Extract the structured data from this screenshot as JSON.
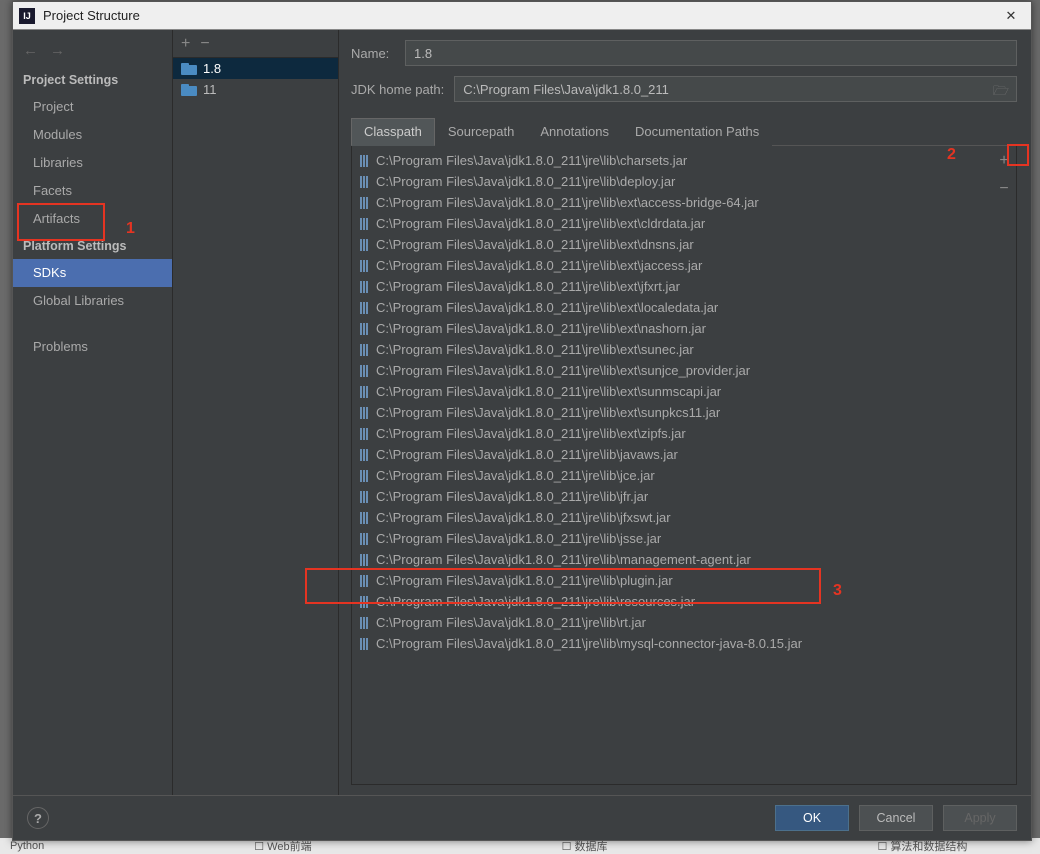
{
  "window": {
    "title": "Project Structure"
  },
  "sidebar": {
    "section1": "Project Settings",
    "section2": "Platform Settings",
    "items1": [
      "Project",
      "Modules",
      "Libraries",
      "Facets",
      "Artifacts"
    ],
    "items2": [
      "SDKs",
      "Global Libraries"
    ],
    "problems": "Problems"
  },
  "sdklist": {
    "items": [
      "1.8",
      "11"
    ]
  },
  "form": {
    "name_label": "Name:",
    "name_value": "1.8",
    "jdkhome_label": "JDK home path:",
    "jdkhome_value": "C:\\Program Files\\Java\\jdk1.8.0_211"
  },
  "tabs": [
    "Classpath",
    "Sourcepath",
    "Annotations",
    "Documentation Paths"
  ],
  "classpath": [
    "C:\\Program Files\\Java\\jdk1.8.0_211\\jre\\lib\\charsets.jar",
    "C:\\Program Files\\Java\\jdk1.8.0_211\\jre\\lib\\deploy.jar",
    "C:\\Program Files\\Java\\jdk1.8.0_211\\jre\\lib\\ext\\access-bridge-64.jar",
    "C:\\Program Files\\Java\\jdk1.8.0_211\\jre\\lib\\ext\\cldrdata.jar",
    "C:\\Program Files\\Java\\jdk1.8.0_211\\jre\\lib\\ext\\dnsns.jar",
    "C:\\Program Files\\Java\\jdk1.8.0_211\\jre\\lib\\ext\\jaccess.jar",
    "C:\\Program Files\\Java\\jdk1.8.0_211\\jre\\lib\\ext\\jfxrt.jar",
    "C:\\Program Files\\Java\\jdk1.8.0_211\\jre\\lib\\ext\\localedata.jar",
    "C:\\Program Files\\Java\\jdk1.8.0_211\\jre\\lib\\ext\\nashorn.jar",
    "C:\\Program Files\\Java\\jdk1.8.0_211\\jre\\lib\\ext\\sunec.jar",
    "C:\\Program Files\\Java\\jdk1.8.0_211\\jre\\lib\\ext\\sunjce_provider.jar",
    "C:\\Program Files\\Java\\jdk1.8.0_211\\jre\\lib\\ext\\sunmscapi.jar",
    "C:\\Program Files\\Java\\jdk1.8.0_211\\jre\\lib\\ext\\sunpkcs11.jar",
    "C:\\Program Files\\Java\\jdk1.8.0_211\\jre\\lib\\ext\\zipfs.jar",
    "C:\\Program Files\\Java\\jdk1.8.0_211\\jre\\lib\\javaws.jar",
    "C:\\Program Files\\Java\\jdk1.8.0_211\\jre\\lib\\jce.jar",
    "C:\\Program Files\\Java\\jdk1.8.0_211\\jre\\lib\\jfr.jar",
    "C:\\Program Files\\Java\\jdk1.8.0_211\\jre\\lib\\jfxswt.jar",
    "C:\\Program Files\\Java\\jdk1.8.0_211\\jre\\lib\\jsse.jar",
    "C:\\Program Files\\Java\\jdk1.8.0_211\\jre\\lib\\management-agent.jar",
    "C:\\Program Files\\Java\\jdk1.8.0_211\\jre\\lib\\plugin.jar",
    "C:\\Program Files\\Java\\jdk1.8.0_211\\jre\\lib\\resources.jar",
    "C:\\Program Files\\Java\\jdk1.8.0_211\\jre\\lib\\rt.jar",
    "C:\\Program Files\\Java\\jdk1.8.0_211\\jre\\lib\\mysql-connector-java-8.0.15.jar"
  ],
  "buttons": {
    "ok": "OK",
    "cancel": "Cancel",
    "apply": "Apply"
  },
  "annotations": {
    "one": "1",
    "two": "2",
    "three": "3"
  },
  "bgstrip": {
    "python": "Python",
    "web": "Web前端",
    "db": "数据库",
    "algo": "算法和数据结构"
  }
}
